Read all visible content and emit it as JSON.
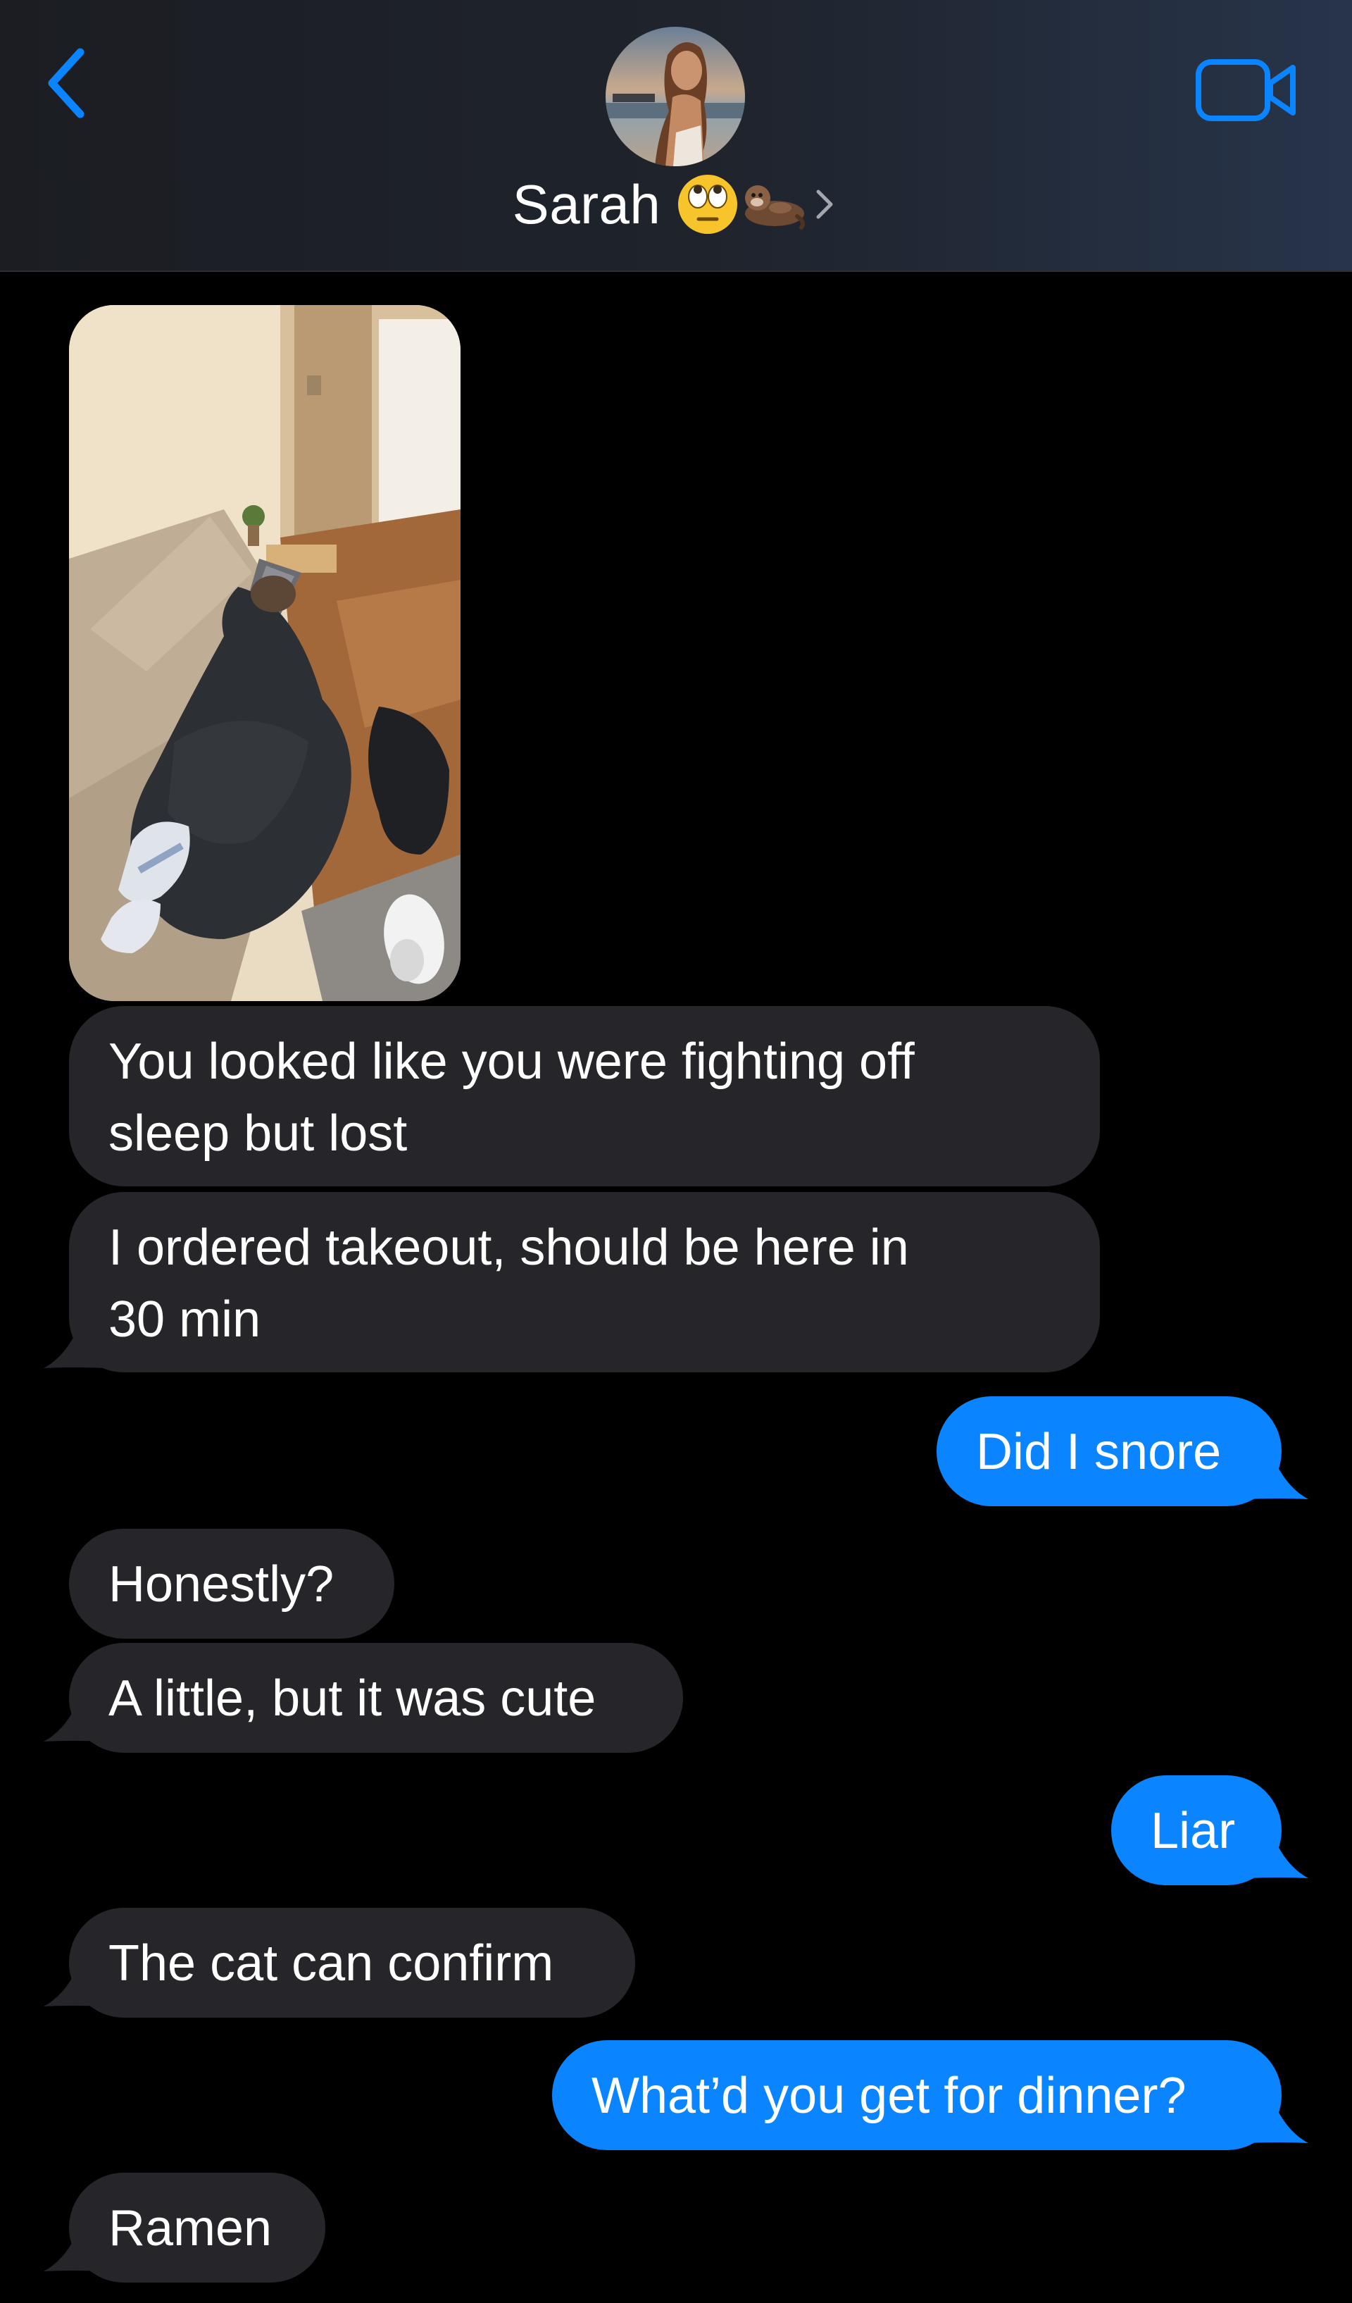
{
  "header": {
    "contact_name": "Sarah",
    "name_emoji": [
      "face-with-rolling-eyes",
      "otter"
    ],
    "back_icon": "chevron-left-icon",
    "video_icon": "video-camera-icon",
    "accent_color": "#0a84ff"
  },
  "messages": [
    {
      "from": "contact",
      "type": "photo",
      "description_icon": "photo"
    },
    {
      "from": "contact",
      "type": "text",
      "lines": [
        "You looked like you were fighting off",
        "sleep but lost"
      ]
    },
    {
      "from": "contact",
      "type": "text",
      "lines": [
        "I ordered takeout, should be here in",
        "30 min"
      ]
    },
    {
      "from": "me",
      "type": "text",
      "text": "Did I snore"
    },
    {
      "from": "contact",
      "type": "text",
      "text": "Honestly?"
    },
    {
      "from": "contact",
      "type": "text",
      "text": "A little, but it was cute"
    },
    {
      "from": "me",
      "type": "text",
      "text": "Liar"
    },
    {
      "from": "contact",
      "type": "text",
      "text": "The cat can confirm"
    },
    {
      "from": "me",
      "type": "text",
      "text": "What’d you get for dinner?"
    },
    {
      "from": "contact",
      "type": "text",
      "text": "Ramen"
    }
  ],
  "colors": {
    "incoming_bubble": "#26262a",
    "outgoing_bubble": "#0a84ff",
    "background": "#000000"
  }
}
